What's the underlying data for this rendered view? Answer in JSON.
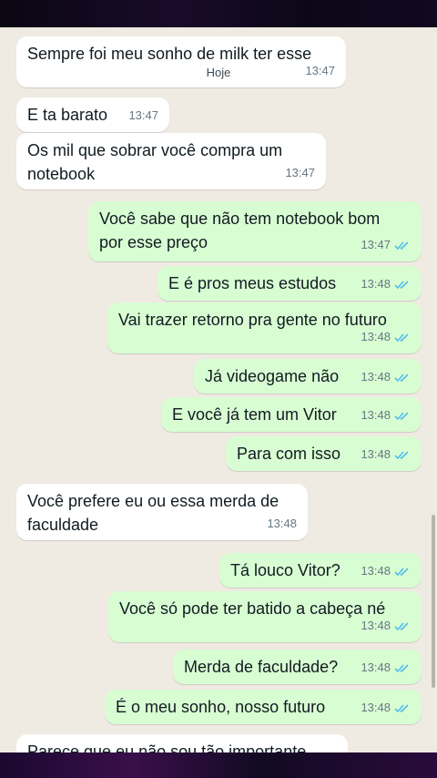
{
  "date_chip": "Hoje",
  "colors": {
    "incoming": "#ffffff",
    "outgoing": "#d9fdd3",
    "read_ticks": "#53bdeb",
    "wallpaper": "#efeae2"
  },
  "messages": [
    {
      "dir": "in",
      "text": "Sempre foi meu sonho de milk ter esse",
      "time": "13:47"
    },
    {
      "dir": "in",
      "text": "E ta barato",
      "time": "13:47"
    },
    {
      "dir": "in",
      "text": "Os mil que sobrar você compra um\nnotebook",
      "time": "13:47"
    },
    {
      "dir": "out",
      "text": "Você sabe que não tem notebook bom\npor esse preço",
      "time": "13:47",
      "status": "read-ticks-icon"
    },
    {
      "dir": "out",
      "text": "E é pros meus estudos",
      "time": "13:48",
      "status": "read-ticks-icon"
    },
    {
      "dir": "out",
      "text": "Vai trazer retorno pra gente no futuro",
      "time": "13:48",
      "status": "read-ticks-icon"
    },
    {
      "dir": "out",
      "text": "Já videogame não",
      "time": "13:48",
      "status": "read-ticks-icon"
    },
    {
      "dir": "out",
      "text": "E você já tem um Vitor",
      "time": "13:48",
      "status": "read-ticks-icon"
    },
    {
      "dir": "out",
      "text": "Para com isso",
      "time": "13:48",
      "status": "read-ticks-icon"
    },
    {
      "dir": "in",
      "text": "Você prefere eu ou essa merda de\nfaculdade",
      "time": "13:48"
    },
    {
      "dir": "out",
      "text": "Tá louco Vitor?",
      "time": "13:48",
      "status": "read-ticks-icon"
    },
    {
      "dir": "out",
      "text": "Você só pode ter batido a cabeça né",
      "time": "13:48",
      "status": "read-ticks-icon"
    },
    {
      "dir": "out",
      "text": "Merda de faculdade?",
      "time": "13:48",
      "status": "read-ticks-icon"
    },
    {
      "dir": "out",
      "text": "É o meu sonho, nosso futuro",
      "time": "13:48",
      "status": "read-ticks-icon"
    },
    {
      "dir": "in",
      "text": "Parece que eu não sou tão importante",
      "time": ""
    }
  ]
}
